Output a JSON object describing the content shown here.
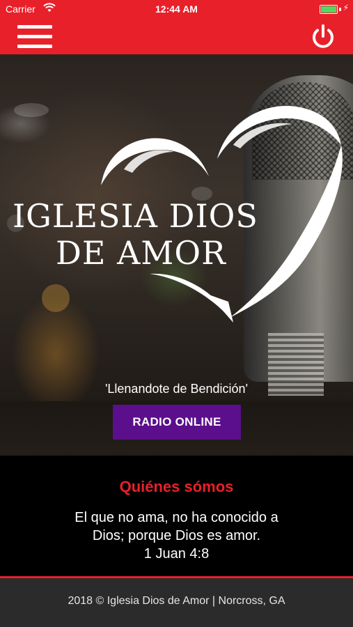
{
  "status_bar": {
    "carrier": "Carrier",
    "time": "12:44 AM",
    "battery_level": 1.0,
    "battery_color": "#4cd964"
  },
  "nav_bar": {
    "background_color": "#e8202a",
    "menu_icon": "hamburger-menu-icon",
    "power_icon": "power-icon"
  },
  "hero": {
    "logo_line_1": "IGLESIA DIOS",
    "logo_line_2": "DE AMOR",
    "tagline": "'Llenandote de Bendición'",
    "radio_button_label": "RADIO ONLINE",
    "radio_button_color": "#5b0f8c"
  },
  "about": {
    "title": "Quiénes sómos",
    "title_color": "#e8202a",
    "verse_line_1": "El que no ama, no ha conocido a",
    "verse_line_2": "Dios; porque Dios es amor.",
    "verse_reference": "1 Juan 4:8"
  },
  "footer": {
    "text": "2018 © Iglesia Dios de Amor | Norcross, GA"
  }
}
